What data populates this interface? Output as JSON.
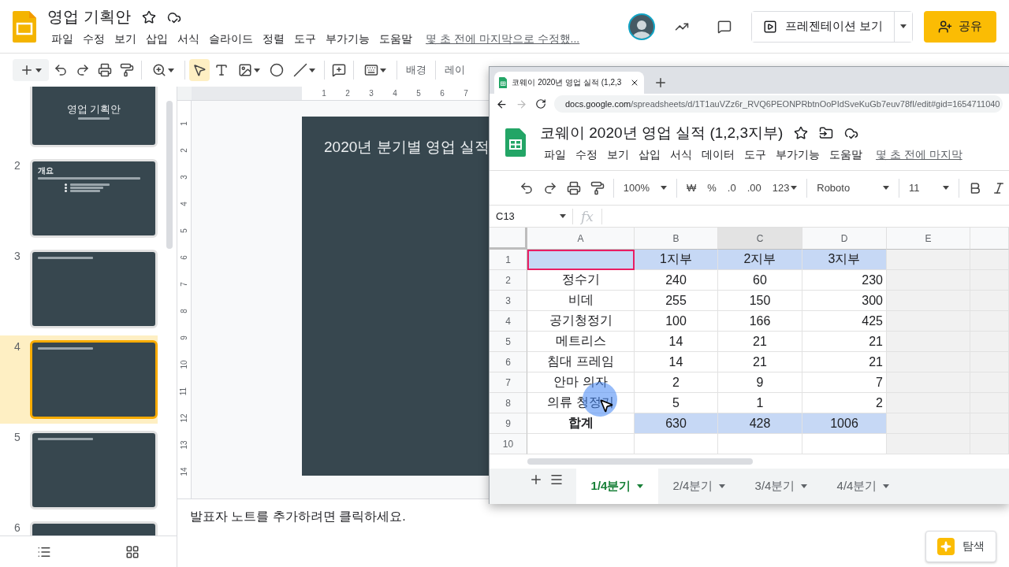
{
  "app": {
    "title": "영업 기획안",
    "menu": [
      "파일",
      "수정",
      "보기",
      "삽입",
      "서식",
      "슬라이드",
      "정렬",
      "도구",
      "부가기능",
      "도움말"
    ],
    "last_edit": "몇 초 전에 마지막으로 수정했...",
    "present_button": "프레젠테이션 보기",
    "share_button": "공유"
  },
  "toolbar": {
    "background_button": "배경",
    "layout_button": "레이"
  },
  "slides": [
    {
      "kind": "title",
      "selected": false,
      "title": "영업 기획안"
    },
    {
      "kind": "bullets",
      "number": "2",
      "selected": false,
      "title": "개요"
    },
    {
      "kind": "heading",
      "number": "3",
      "selected": false
    },
    {
      "kind": "heading",
      "number": "4",
      "selected": true
    },
    {
      "kind": "heading",
      "number": "5",
      "selected": false
    },
    {
      "kind": "blank",
      "number": "6",
      "selected": false
    }
  ],
  "ruler": {
    "horizontal": [
      "1",
      "2",
      "3",
      "4",
      "5",
      "6",
      "7"
    ],
    "vertical": [
      "1",
      "2",
      "3",
      "4",
      "5",
      "6",
      "7",
      "8",
      "9",
      "10",
      "11",
      "12",
      "13",
      "14"
    ]
  },
  "current_slide": {
    "title": "2020년 분기별 영업 실적"
  },
  "speaker_notes": {
    "placeholder": "발표자 노트를 추가하려면 클릭하세요."
  },
  "explore_button": "탐색",
  "sheet_window": {
    "tab_title": "코웨이 2020년 영업 실적 (1,2,3",
    "url_host": "docs.google.com",
    "url_path": "/spreadsheets/d/1T1auVZz6r_RVQ6PEONPRbtnOoPIdSveKuGb7euv78fI/edit#gid=1654711040",
    "title": "코웨이 2020년 영업 실적 (1,2,3지부)",
    "menu": [
      "파일",
      "수정",
      "보기",
      "삽입",
      "서식",
      "데이터",
      "도구",
      "부가기능",
      "도움말"
    ],
    "last_edit": "몇 초 전에 마지막",
    "toolbar": {
      "zoom": "100%",
      "currency": "₩",
      "percent": "%",
      "decrease_decimal": ".0",
      "increase_decimal": ".00",
      "number_format": "123",
      "font": "Roboto",
      "font_size": "11"
    },
    "name_box": "C13",
    "formula_label": "fx",
    "grid": {
      "columns": [
        {
          "label": "A",
          "selected": false
        },
        {
          "label": "B",
          "selected": false
        },
        {
          "label": "C",
          "selected": true
        },
        {
          "label": "D",
          "selected": false
        },
        {
          "label": "E",
          "selected": false
        }
      ],
      "rows": [
        {
          "number": "1",
          "cells": [
            {
              "selected": true,
              "active": true
            },
            {
              "text": "1지부",
              "selected": true
            },
            {
              "text": "2지부",
              "selected": true
            },
            {
              "text": "3지부",
              "selected": true
            }
          ]
        },
        {
          "number": "2",
          "cells": [
            {
              "text": "정수기",
              "selected": false
            },
            {
              "text": "240",
              "selected": false
            },
            {
              "text": "60",
              "selected": false
            },
            {
              "text": "230",
              "selected": false,
              "right_aligned": true
            }
          ]
        },
        {
          "number": "3",
          "cells": [
            {
              "text": "비데",
              "selected": false
            },
            {
              "text": "255",
              "selected": false
            },
            {
              "text": "150",
              "selected": false
            },
            {
              "text": "300",
              "selected": false,
              "right_aligned": true
            }
          ]
        },
        {
          "number": "4",
          "cells": [
            {
              "text": "공기청정기",
              "selected": false
            },
            {
              "text": "100",
              "selected": false
            },
            {
              "text": "166",
              "selected": false
            },
            {
              "text": "425",
              "selected": false,
              "right_aligned": true
            }
          ]
        },
        {
          "number": "5",
          "cells": [
            {
              "text": "메트리스",
              "selected": false
            },
            {
              "text": "14",
              "selected": false
            },
            {
              "text": "21",
              "selected": false
            },
            {
              "text": "21",
              "selected": false,
              "right_aligned": true
            }
          ]
        },
        {
          "number": "6",
          "cells": [
            {
              "text": "침대 프레임",
              "selected": false
            },
            {
              "text": "14",
              "selected": false
            },
            {
              "text": "21",
              "selected": false
            },
            {
              "text": "21",
              "selected": false,
              "right_aligned": true
            }
          ]
        },
        {
          "number": "7",
          "cells": [
            {
              "text": "안마 의자",
              "selected": false
            },
            {
              "text": "2",
              "selected": false
            },
            {
              "text": "9",
              "selected": false
            },
            {
              "text": "7",
              "selected": false,
              "right_aligned": true
            }
          ]
        },
        {
          "number": "8",
          "cells": [
            {
              "text": "의류 청정기",
              "selected": false
            },
            {
              "text": "5",
              "selected": false
            },
            {
              "text": "1",
              "selected": false
            },
            {
              "text": "2",
              "selected": false,
              "right_aligned": true
            }
          ]
        },
        {
          "number": "9",
          "cells": [
            {
              "text": "합계",
              "selected": false,
              "bold": true
            },
            {
              "text": "630",
              "selected": true
            },
            {
              "text": "428",
              "selected": true
            },
            {
              "text": "1006",
              "selected": true
            }
          ]
        },
        {
          "number": "10",
          "cells": [
            {
              "selected": false
            },
            {
              "selected": false
            },
            {
              "selected": false
            },
            {
              "selected": false
            }
          ]
        }
      ]
    },
    "sheet_tabs": [
      {
        "label": "1/4분기",
        "selected": true
      },
      {
        "label": "2/4분기",
        "selected": false
      },
      {
        "label": "3/4분기",
        "selected": false
      },
      {
        "label": "4/4분기",
        "selected": false
      }
    ]
  }
}
